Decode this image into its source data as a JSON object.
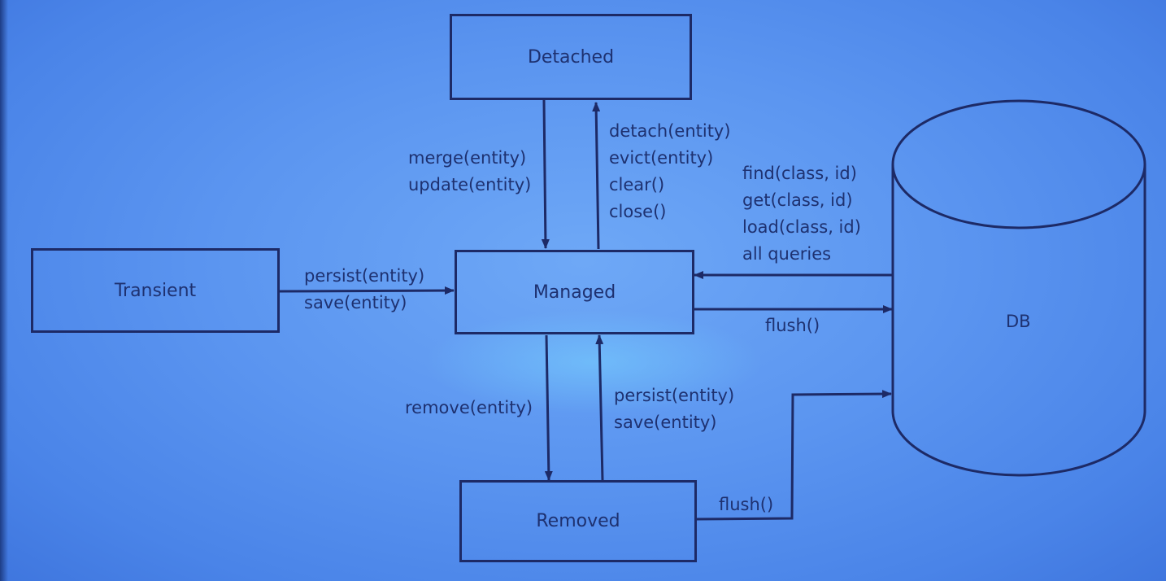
{
  "states": {
    "detached": "Detached",
    "transient": "Transient",
    "managed": "Managed",
    "removed": "Removed",
    "db": "DB"
  },
  "transitions": {
    "managed_to_detached": [
      "detach(entity)",
      "evict(entity)",
      "clear()",
      "close()"
    ],
    "detached_to_managed": [
      "merge(entity)",
      "update(entity)"
    ],
    "transient_to_managed": [
      "persist(entity)",
      "save(entity)"
    ],
    "db_to_managed": [
      "find(class, id)",
      "get(class, id)",
      "load(class, id)",
      "all queries"
    ],
    "managed_to_db": "flush()",
    "managed_to_removed": "remove(entity)",
    "removed_to_managed": [
      "persist(entity)",
      "save(entity)"
    ],
    "removed_to_db": "flush()"
  },
  "colors": {
    "background": "#5b95f0",
    "line": "#1d2a66",
    "text": "#1e3170"
  }
}
